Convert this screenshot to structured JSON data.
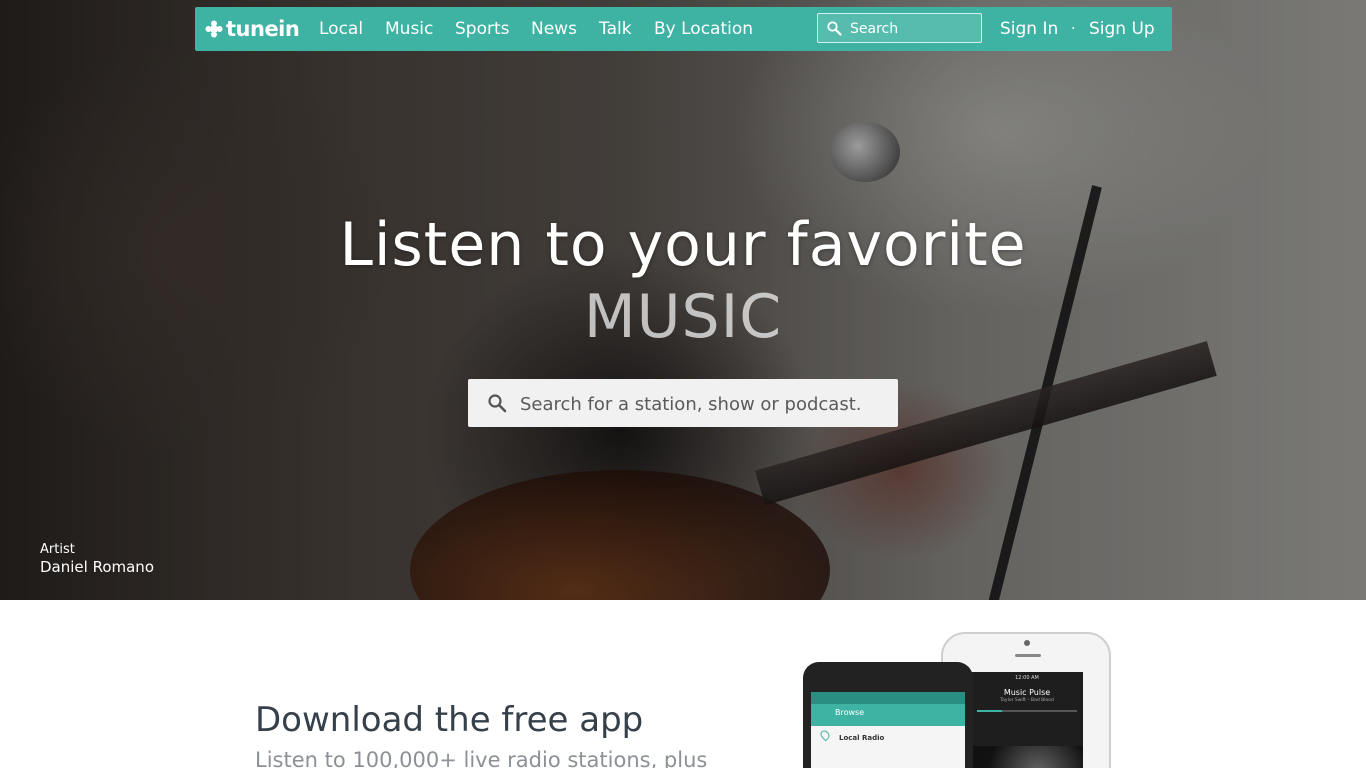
{
  "brand": {
    "logo_text": "tunein",
    "logo_icon": "tunein-plus-icon",
    "accent_color": "#3fb3a3"
  },
  "nav": {
    "items": [
      {
        "label": "Local"
      },
      {
        "label": "Music"
      },
      {
        "label": "Sports"
      },
      {
        "label": "News"
      },
      {
        "label": "Talk"
      },
      {
        "label": "By Location"
      }
    ],
    "search_placeholder": "Search",
    "sign_in": "Sign In",
    "separator": "·",
    "sign_up": "Sign Up"
  },
  "hero": {
    "headline": "Listen to your favorite",
    "category": "MUSIC",
    "search_placeholder": "Search for a station, show or podcast.",
    "credit_label": "Artist",
    "credit_name": "Daniel Romano"
  },
  "download": {
    "title": "Download the free app",
    "text": "Listen to 100,000+ live radio stations, plus"
  },
  "phones": {
    "android": {
      "appbar_title": "Browse",
      "row_title": "Local Radio"
    },
    "iphone": {
      "status_time": "12:00 AM",
      "now_playing_title": "Music Pulse",
      "now_playing_sub": "Taylor Swift – Bad Blood",
      "progress": 0.25
    }
  }
}
